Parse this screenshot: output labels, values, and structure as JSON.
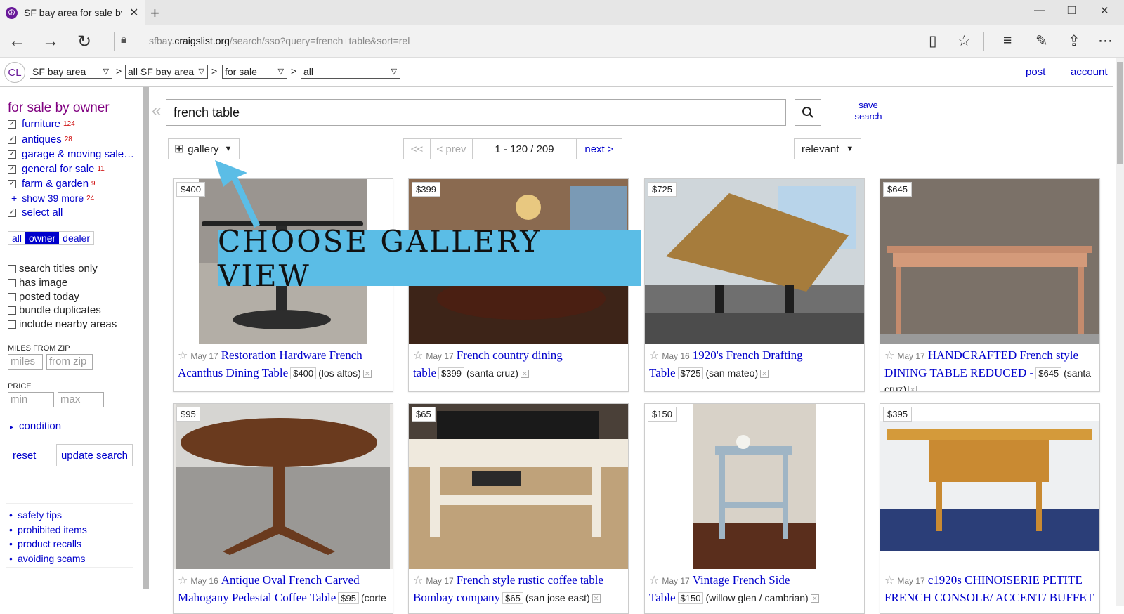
{
  "browser": {
    "tab_title": "SF bay area for sale by c",
    "url_prefix": "sfbay.",
    "url_domain": "craigslist.org",
    "url_path": "/search/sso?query=french+table&sort=rel"
  },
  "header": {
    "logo": "CL",
    "area": "SF bay area",
    "subarea": "all SF bay area",
    "section": "for sale",
    "category": "all",
    "post_label": "post",
    "account_label": "account"
  },
  "sidebar": {
    "title": "for sale by owner",
    "categories": [
      {
        "label": "furniture",
        "count": "124"
      },
      {
        "label": "antiques",
        "count": "28"
      },
      {
        "label": "garage & moving sale…",
        "count": ""
      },
      {
        "label": "general for sale",
        "count": "11"
      },
      {
        "label": "farm & garden",
        "count": "9"
      }
    ],
    "show_more": "show 39 more",
    "show_more_count": "24",
    "select_all": "select all",
    "seller_types": [
      "all",
      "owner",
      "dealer"
    ],
    "options": [
      "search titles only",
      "has image",
      "posted today",
      "bundle duplicates",
      "include nearby areas"
    ],
    "miles_label": "MILES FROM ZIP",
    "miles_placeholder": "miles",
    "zip_placeholder": "from zip",
    "price_label": "PRICE",
    "min_placeholder": "min",
    "max_placeholder": "max",
    "condition_label": "condition",
    "reset_label": "reset",
    "update_label": "update search",
    "help_links": [
      "safety tips",
      "prohibited items",
      "product recalls",
      "avoiding scams"
    ]
  },
  "search": {
    "query": "french table",
    "save_line1": "save",
    "save_line2": "search",
    "view_label": "gallery",
    "pager_first": "<<",
    "pager_prev": "< prev",
    "pager_range": "1 - 120 / 209",
    "pager_next": "next >",
    "sort_label": "relevant"
  },
  "banner_text": "CHOOSE GALLERY VIEW",
  "listings": [
    {
      "price": "$400",
      "date": "May 17",
      "title": "Restoration Hardware French Acanthus Dining Table",
      "location": "(los altos)"
    },
    {
      "price": "$399",
      "date": "May 17",
      "title": "French country dining table",
      "location": "(santa cruz)"
    },
    {
      "price": "$725",
      "date": "May 16",
      "title": "1920's French Drafting Table",
      "location": "(san mateo)"
    },
    {
      "price": "$645",
      "date": "May 17",
      "title": "HANDCRAFTED French style DINING TABLE REDUCED -",
      "location": "(santa cruz)"
    },
    {
      "price": "$95",
      "date": "May 16",
      "title": "Antique Oval French Carved Mahogany Pedestal Coffee Table",
      "location": "(corte"
    },
    {
      "price": "$65",
      "date": "May 17",
      "title": "French style rustic coffee table Bombay company",
      "location": "(san jose east)"
    },
    {
      "price": "$150",
      "date": "May 17",
      "title": "Vintage French Side Table",
      "location": "(willow glen / cambrian)"
    },
    {
      "price": "$395",
      "date": "May 17",
      "title": "c1920s CHINOISERIE PETITE FRENCH CONSOLE/ ACCENT/ BUFFET",
      "location": ""
    }
  ]
}
